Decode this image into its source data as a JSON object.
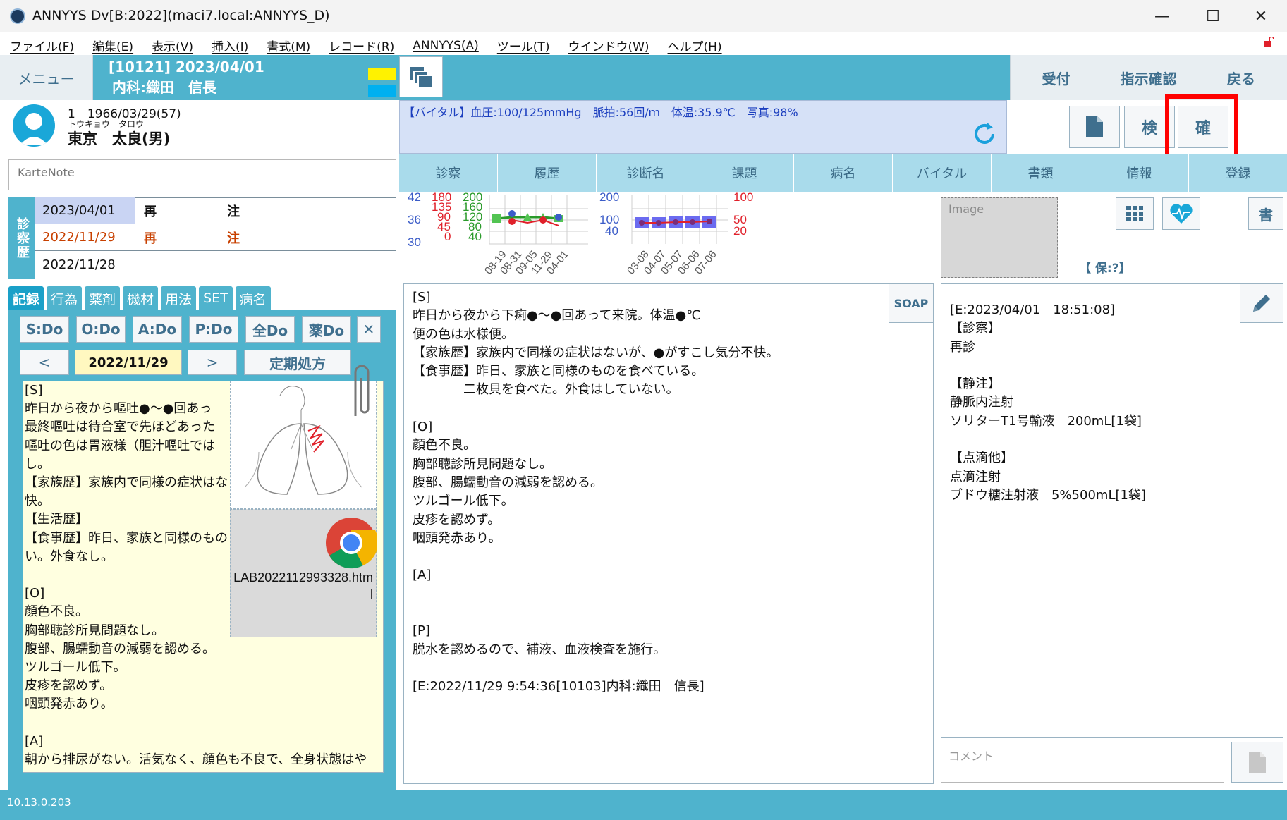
{
  "window": {
    "title": "ANNYYS Dv[B:2022](maci7.local:ANNYYS_D)",
    "minimize": "—",
    "maximize": "☐",
    "close": "✕"
  },
  "menus": [
    "ファイル(F)",
    "編集(E)",
    "表示(V)",
    "挿入(I)",
    "書式(M)",
    "レコード(R)",
    "ANNYYS(A)",
    "ツール(T)",
    "ウインドウ(W)",
    "ヘルプ(H)"
  ],
  "toolbar": {
    "menu_label": "メニュー",
    "header_line1": "[10121] 2023/04/01",
    "header_line2": "内科:織田　信長",
    "reception": "受付",
    "instruction_check": "指示確認",
    "back": "戻る"
  },
  "patient": {
    "line1": "1　1966/03/29(57)",
    "kana": "トウキョウ　タロウ",
    "name": "東京　太良(男)"
  },
  "karte_note": {
    "placeholder": "KarteNote"
  },
  "vital": {
    "text": "【バイタル】血圧:100/125mmHg　脈拍:56回/ｍ　体温:35.9℃　写真:98%"
  },
  "action_buttons": {
    "doc_icon": "document-icon",
    "inspect": "検",
    "confirm": "確"
  },
  "main_tabs": [
    "診察",
    "履歴",
    "診断名",
    "課題",
    "病名",
    "バイタル",
    "書類",
    "情報",
    "登録"
  ],
  "history": {
    "label": "診察歴",
    "rows": [
      {
        "date": "2023/04/01",
        "kind": "再",
        "note": "注"
      },
      {
        "date": "2022/11/29",
        "kind": "再",
        "note": "注"
      },
      {
        "date": "2022/11/28",
        "kind": "",
        "note": ""
      }
    ]
  },
  "left_tabs": [
    "記録",
    "行為",
    "薬剤",
    "機材",
    "用法",
    "SET",
    "病名"
  ],
  "do_buttons": [
    "S:Do",
    "O:Do",
    "A:Do",
    "P:Do",
    "全Do",
    "薬Do"
  ],
  "date_nav": {
    "prev": "<",
    "date": "2022/11/29",
    "next": ">",
    "regular": "定期処方",
    "close": "✕"
  },
  "left_record": [
    "[S]",
    "昨日から夜から嘔吐●～●回あっ",
    "最終嘔吐は待合室で先ほどあった",
    "嘔吐の色は胃液様（胆汁嘔吐では",
    "し。",
    "【家族歴】家族内で同様の症状はな",
    "快。",
    "【生活歴】",
    "【食事歴】昨日、家族と同様のもの",
    "い。外食なし。",
    "",
    "[O]",
    "顔色不良。",
    "胸部聴診所見問題なし。",
    "腹部、腸蠕動音の減弱を認める。",
    "ツルゴール低下。",
    "皮疹を認めず。",
    "咽頭発赤あり。",
    "",
    "[A]",
    "朝から排尿がない。活気なく、顔色も不良で、全身状態はや"
  ],
  "attachment": {
    "html_file": "LAB2022112993328.html"
  },
  "graph": {
    "left_axis": {
      "blue": [
        "42",
        "36",
        "30"
      ],
      "red": [
        "180",
        "135",
        "90",
        "45",
        "0"
      ],
      "green": [
        "200",
        "160",
        "120",
        "80",
        "40"
      ]
    },
    "left_dates": [
      "08-19",
      "08-31",
      "09-05",
      "11-29",
      "04-01"
    ],
    "right_axis": {
      "blue": [
        "200",
        "100",
        "40"
      ],
      "red": [
        "100",
        "50",
        "20"
      ]
    },
    "right_dates": [
      "03-08",
      "04-07",
      "05-07",
      "06-06",
      "07-06"
    ]
  },
  "soap": {
    "button": "SOAP",
    "lines": [
      "[S]",
      "昨日から夜から下痢●～●回あって来院。体温●℃",
      "便の色は水様便。",
      "【家族歴】家族内で同様の症状はないが、●がすこし気分不快。",
      "【食事歴】昨日、家族と同様のものを食べている。",
      "　　　　二枚貝を食べた。外食はしていない。",
      "",
      "[O]",
      "顔色不良。",
      "胸部聴診所見問題なし。",
      "腹部、腸蠕動音の減弱を認める。",
      "ツルゴール低下。",
      "皮疹を認めず。",
      "咽頭発赤あり。",
      "",
      "[A]",
      "",
      "",
      "[P]",
      "脱水を認めるので、補液、血液検査を施行。",
      "",
      "[E:2022/11/29 9:54:36[10103]内科:織田　信長]"
    ]
  },
  "right_panel": {
    "image_label": "Image",
    "hoken": "【 保:?】",
    "write_btn": "書",
    "order_lines": [
      "[E:2023/04/01　18:51:08]",
      "【診察】",
      "再診",
      "",
      "【静注】",
      "静脈内注射",
      "ソリターT1号輸液　200mL[1袋]",
      "",
      "【点滴他】",
      "点滴注射",
      "ブドウ糖注射液　5%500mL[1袋]"
    ],
    "comment_placeholder": "コメント"
  },
  "status": {
    "version": "10.13.0.203"
  },
  "colors": {
    "accent": "#4fb3cd",
    "highlight": "#ff0000",
    "vital_bg": "#d6e1f7",
    "record_bg": "#ffffe0"
  }
}
